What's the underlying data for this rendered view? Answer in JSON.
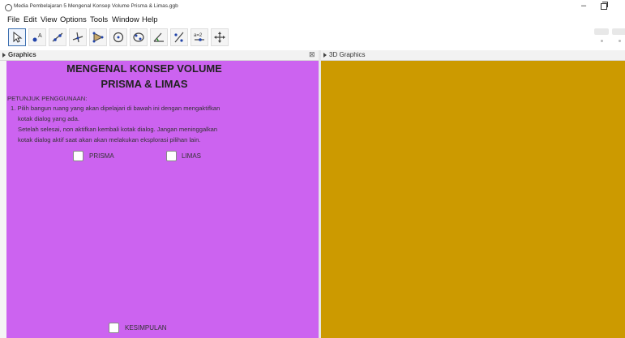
{
  "window": {
    "title": "Media Pembelajaran 5 Mengenal Konsep Volume Prisma & Limas.ggb",
    "minimize_symbol": "–"
  },
  "menu": [
    "File",
    "Edit",
    "View",
    "Options",
    "Tools",
    "Window",
    "Help"
  ],
  "toolbar": {
    "tools": [
      "move-tool",
      "point-tool",
      "line-tool",
      "perpendicular-tool",
      "polygon-tool",
      "circle-tool",
      "conic-tool",
      "angle-tool",
      "reflect-tool",
      "slider-tool",
      "move-view-tool"
    ],
    "slider_icon_text": "a=2",
    "selected_index": 0
  },
  "panels": {
    "graphics": {
      "title": "Graphics",
      "background": "#cc63f0",
      "close_symbol": "⊠"
    },
    "graphics3d": {
      "title": "3D Graphics",
      "background": "#cc9a00"
    }
  },
  "content": {
    "title_line1": "MENGENAL KONSEP VOLUME",
    "title_line2": "PRISMA & LIMAS",
    "instructions_heading": "PETUNJUK PENGGUNAAN:",
    "instruction_lines": [
      "1. Pilih bangun ruang yang akan dipelajari di bawah ini dengan mengaktifkan",
      "kotak dialog yang ada.",
      "Setelah selesai, non aktifkan kembali kotak dialog. Jangan meninggalkan",
      "kotak dialog aktif saat akan akan melakukan eksplorasi pilihan lain."
    ],
    "checkboxes": {
      "prisma": {
        "label": "PRISMA",
        "checked": false
      },
      "limas": {
        "label": "LIMAS",
        "checked": false
      },
      "kesimpulan": {
        "label": "KESIMPULAN",
        "checked": false
      }
    }
  }
}
